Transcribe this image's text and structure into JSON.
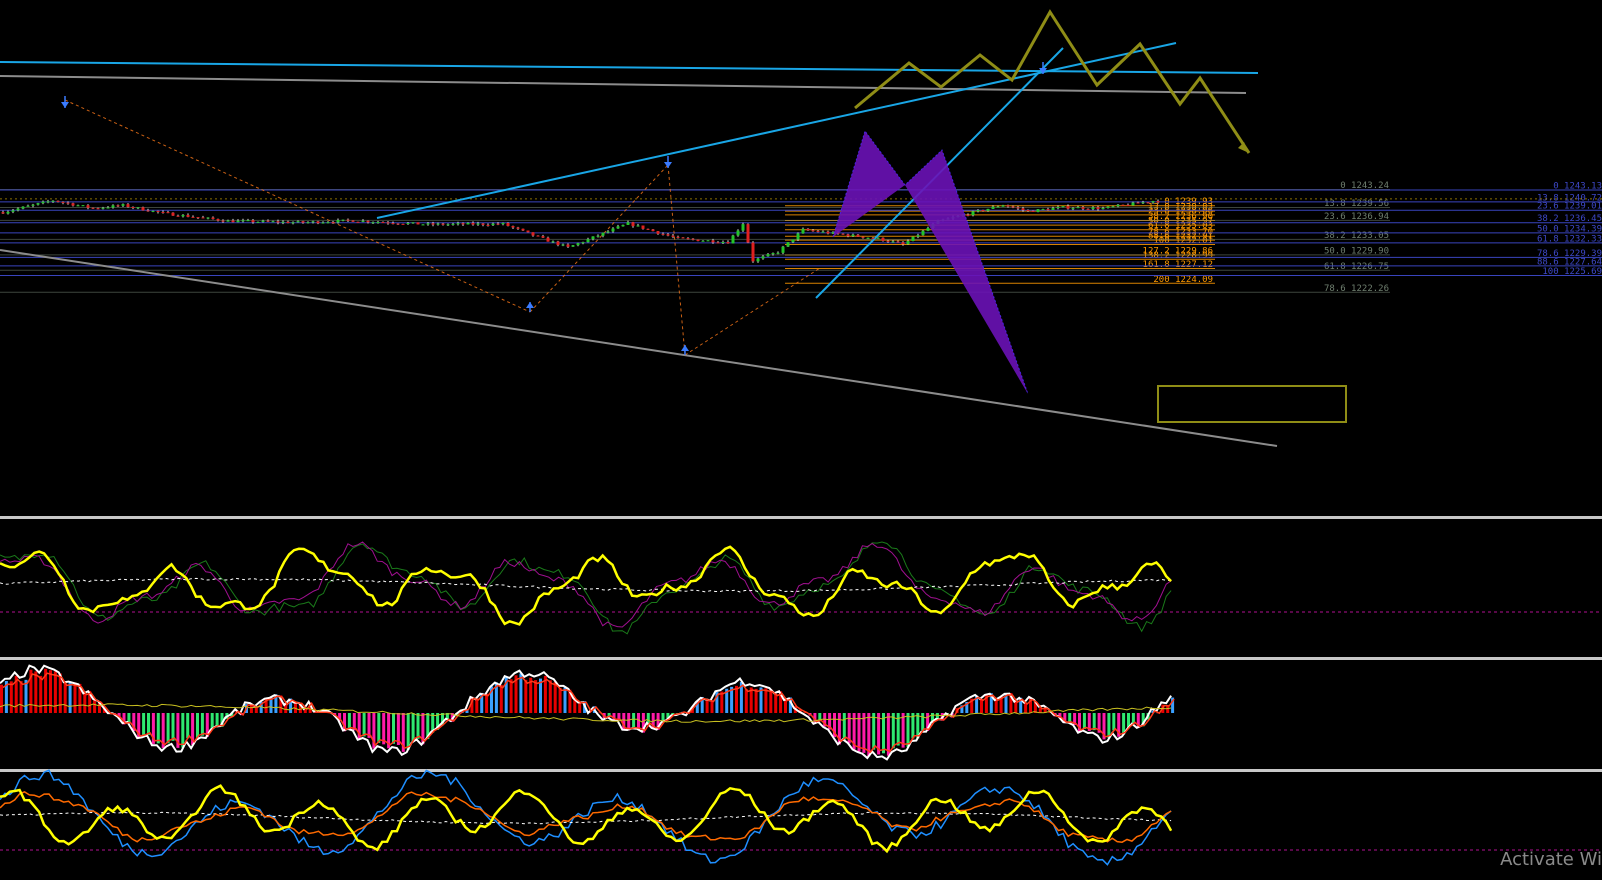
{
  "colors": {
    "background": "#000000",
    "candle_up": "#22c52a",
    "candle_down": "#e02020",
    "wick": "#dddddd",
    "fib_left": "#ff9900",
    "fib_mid": "#6f7f6f",
    "fib_right": "#3d48c8",
    "channel": "#19a6e6",
    "grey_trend": "#8c8c8c",
    "projection": "#8f8d16",
    "harmonic": "#6a12b6",
    "osc_main": "#ffff00",
    "osc_signal_green": "#1a7a1a",
    "osc_signal_magenta": "#a01090",
    "hist_blue": "#3aa0ff",
    "hist_red": "#e80000",
    "hist_green": "#2ee870",
    "hist_pink": "#ff1aa8",
    "osc3_blue": "#1f8fff",
    "osc3_orange": "#ff6a00",
    "separator": "#c8c8c8"
  },
  "chart_data": [
    {
      "type": "candlestick",
      "panel": "price",
      "title": "",
      "grid": false,
      "y_range": [
        1221.5,
        1246.0
      ],
      "x_count": 232,
      "price_pivots": [
        [
          0,
          1238.6
        ],
        [
          10,
          1241.0
        ],
        [
          14,
          1240.2
        ],
        [
          18,
          1239.4
        ],
        [
          24,
          1240.0
        ],
        [
          32,
          1238.4
        ],
        [
          45,
          1236.8
        ],
        [
          60,
          1236.5
        ],
        [
          70,
          1236.9
        ],
        [
          85,
          1236.1
        ],
        [
          100,
          1236.2
        ],
        [
          107,
          1233.5
        ],
        [
          113,
          1231.4
        ],
        [
          125,
          1236.3
        ],
        [
          135,
          1233.2
        ],
        [
          145,
          1232.5
        ],
        [
          148,
          1236.3
        ],
        [
          150,
          1228.7
        ],
        [
          155,
          1230.5
        ],
        [
          160,
          1235.0
        ],
        [
          175,
          1233.2
        ],
        [
          180,
          1232.0
        ],
        [
          187,
          1236.7
        ],
        [
          192,
          1238.0
        ],
        [
          200,
          1240.1
        ],
        [
          205,
          1238.8
        ],
        [
          212,
          1239.6
        ],
        [
          220,
          1239.4
        ],
        [
          230,
          1240.9
        ],
        [
          242,
          1240.3
        ],
        [
          255,
          1239.5
        ],
        [
          262,
          1239.8
        ],
        [
          268,
          1239.4
        ]
      ],
      "fib_left": {
        "color": "#ff9900",
        "levels": [
          {
            "label": "0 1239.93",
            "value": 1239.93
          },
          {
            "label": "13.8 1238.83",
            "value": 1238.83
          },
          {
            "label": "23.6 1238.06",
            "value": 1238.06
          },
          {
            "label": "38.2 1236.90",
            "value": 1236.9
          },
          {
            "label": "50.0 1235.97",
            "value": 1235.97
          },
          {
            "label": "61.8 1235.03",
            "value": 1235.03
          },
          {
            "label": "78.6 1233.70",
            "value": 1233.7
          },
          {
            "label": "88.6 1232.91",
            "value": 1232.91
          },
          {
            "label": "100 1232.01",
            "value": 1232.01
          },
          {
            "label": "127.2 1229.86",
            "value": 1229.86
          },
          {
            "label": "138.2 1228.99",
            "value": 1228.99
          },
          {
            "label": "161.8 1227.12",
            "value": 1227.12
          },
          {
            "label": "200 1224.09",
            "value": 1224.09
          }
        ]
      },
      "fib_mid": {
        "color": "#6f7f6f",
        "levels": [
          {
            "label": "0 1243.24",
            "value": 1243.24
          },
          {
            "label": "13.8 1239.56",
            "value": 1239.56
          },
          {
            "label": "23.6 1236.94",
            "value": 1236.94
          },
          {
            "label": "38.2 1233.05",
            "value": 1233.05
          },
          {
            "label": "50.0 1229.90",
            "value": 1229.9
          },
          {
            "label": "61.8 1226.75",
            "value": 1226.75
          },
          {
            "label": "78.6 1222.26",
            "value": 1222.26
          }
        ]
      },
      "fib_right": {
        "color": "#3d48c8",
        "levels": [
          {
            "label": "0 1243.13",
            "value": 1243.13
          },
          {
            "label": "13.8 1240.72",
            "value": 1240.72
          },
          {
            "label": "23.6 1239.01",
            "value": 1239.01
          },
          {
            "label": "38.2 1236.45",
            "value": 1236.45
          },
          {
            "label": "50.0 1234.39",
            "value": 1234.39
          },
          {
            "label": "61.8 1232.33",
            "value": 1232.33
          },
          {
            "label": "78.6 1229.39",
            "value": 1229.39
          },
          {
            "label": "88.6 1227.64",
            "value": 1227.64
          },
          {
            "label": "100 1225.69",
            "value": 1225.69
          }
        ]
      },
      "annotations": {
        "target_zone": "161.8 1227.12",
        "harmonic_pattern": "purple",
        "projection_path": "zigzag"
      }
    },
    {
      "type": "line",
      "panel": "oscillator-1",
      "series": [
        {
          "key": "main"
        },
        {
          "key": "signal-a"
        },
        {
          "key": "signal-b"
        },
        {
          "key": "average"
        }
      ],
      "grid": false
    },
    {
      "type": "bar",
      "panel": "oscillator-2",
      "series": [
        {
          "key": "histogram"
        },
        {
          "key": "fast-line"
        },
        {
          "key": "slow-line"
        },
        {
          "key": "long-average"
        }
      ],
      "grid": false
    },
    {
      "type": "line",
      "panel": "oscillator-3",
      "series": [
        {
          "key": "fast"
        },
        {
          "key": "outer"
        },
        {
          "key": "mid"
        },
        {
          "key": "average"
        }
      ],
      "grid": false
    }
  ],
  "watermark": {
    "text": "Activate Wi"
  }
}
